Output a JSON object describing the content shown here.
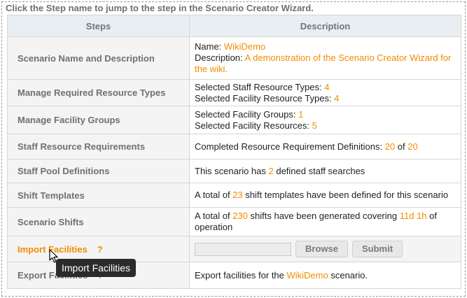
{
  "intro": "Click the Step name to jump to the step in the Scenario Creator Wizard.",
  "headers": {
    "steps": "Steps",
    "description": "Description"
  },
  "rows": {
    "name_desc": {
      "step": "Scenario Name and Description",
      "name_label": "Name: ",
      "name_value": "WikiDemo",
      "desc_label": "Description: ",
      "desc_value": "A demonstration of the Scenario Creator Wizard for the wiki."
    },
    "resource_types": {
      "step": "Manage Required Resource Types",
      "staff_label": "Selected Staff Resource Types: ",
      "staff_value": "4",
      "facility_label": "Selected Facility Resource Types: ",
      "facility_value": "4"
    },
    "facility_groups": {
      "step": "Manage Facility Groups",
      "groups_label": "Selected Facility Groups: ",
      "groups_value": "1",
      "resources_label": "Selected Facility Resources: ",
      "resources_value": "5"
    },
    "staff_requirements": {
      "step": "Staff Resource Requirements",
      "label": "Completed Resource Requirement Definitions: ",
      "completed": "20",
      "of": " of ",
      "total": "20"
    },
    "staff_pool": {
      "step": "Staff Pool Definitions",
      "pre": "This scenario has ",
      "count": "2",
      "post": " defined staff searches"
    },
    "shift_templates": {
      "step": "Shift Templates",
      "pre": "A total of ",
      "count": "23",
      "post": " shift templates have been defined for this scenario"
    },
    "scenario_shifts": {
      "step": "Scenario Shifts",
      "pre": "A total of ",
      "count": "230",
      "mid": " shifts have been generated covering ",
      "duration": "11d 1h",
      "post": " of operation"
    },
    "import_facilities": {
      "step": "Import Facilities",
      "help": "?",
      "browse": "Browse",
      "submit": "Submit"
    },
    "export_facilities": {
      "step": "Export Facilities",
      "help": "?",
      "pre": "Export facilities for the ",
      "scenario": "WikiDemo",
      "post": " scenario."
    }
  },
  "tooltip": "Import Facilities",
  "colors": {
    "accent": "#f28c00",
    "header_bg": "#e9eef3",
    "step_bg": "#f4f4f4",
    "tooltip_bg": "#2b2b2b"
  }
}
